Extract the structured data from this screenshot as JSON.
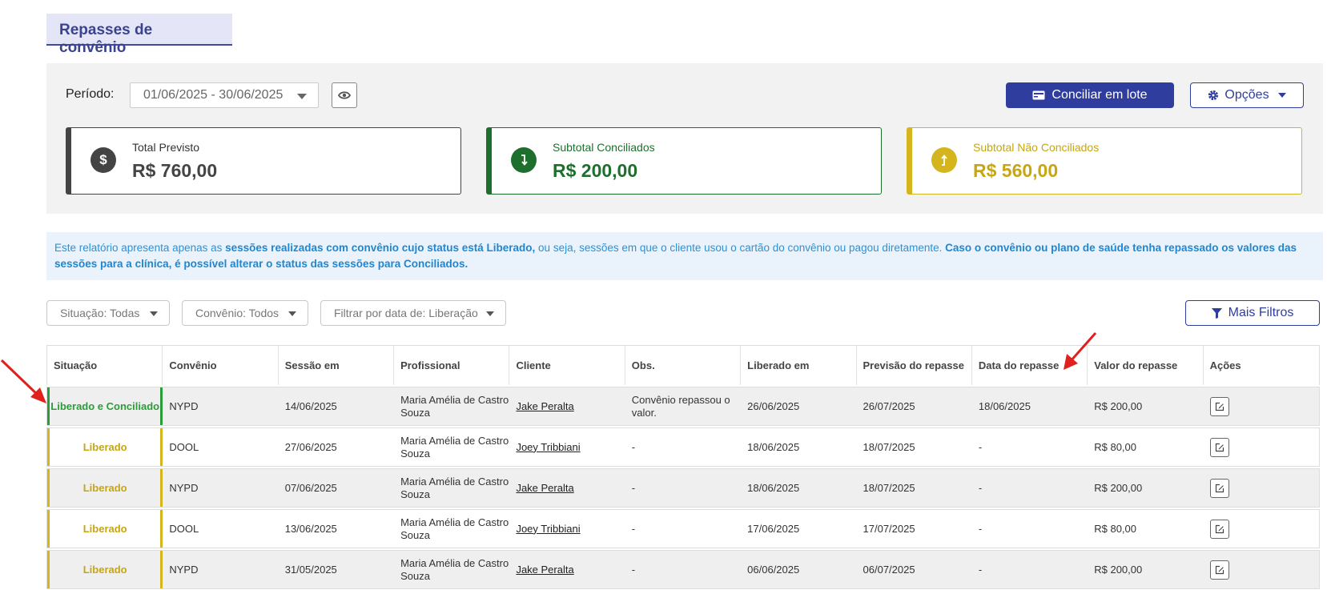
{
  "header": {
    "title": "Repasses de convênio"
  },
  "period": {
    "label": "Período:",
    "value": "01/06/2025 - 30/06/2025"
  },
  "toolbar": {
    "reconcile_batch_label": "Conciliar em lote",
    "options_label": "Opções"
  },
  "cards": {
    "total": {
      "label": "Total Previsto",
      "value": "R$ 760,00"
    },
    "conciliados": {
      "label": "Subtotal Conciliados",
      "value": "R$ 200,00"
    },
    "nao_conciliados": {
      "label": "Subtotal Não Conciliados",
      "value": "R$ 560,00"
    }
  },
  "info": {
    "p1": "Este relatório apresenta apenas as ",
    "b1": "sessões realizadas com convênio cujo status está Liberado,",
    "p2": " ou seja, sessões em que o cliente usou o cartão do convênio ou pagou diretamente. ",
    "b2": "Caso o convênio ou plano de saúde tenha repassado os valores das sessões para a clínica, é possível alterar o status das sessões para Conciliados."
  },
  "filters": {
    "situacao": "Situação: Todas",
    "convenio": "Convênio: Todos",
    "data": "Filtrar por data de: Liberação",
    "more_label": "Mais Filtros"
  },
  "table": {
    "columns": [
      "Situação",
      "Convênio",
      "Sessão em",
      "Profissional",
      "Cliente",
      "Obs.",
      "Liberado em",
      "Previsão do repasse",
      "Data do repasse",
      "Valor do repasse",
      "Ações"
    ],
    "rows": [
      {
        "status": "Liberado e Conciliado",
        "status_type": "conciliado",
        "convenio": "NYPD",
        "sessao": "14/06/2025",
        "profissional": "Maria Amélia de Castro Souza",
        "cliente": "Jake Peralta",
        "obs": "Convênio repassou o valor.",
        "liberado": "26/06/2025",
        "previsao": "26/07/2025",
        "data_repasse": "18/06/2025",
        "valor": "R$ 200,00"
      },
      {
        "status": "Liberado",
        "status_type": "liberado",
        "convenio": "DOOL",
        "sessao": "27/06/2025",
        "profissional": "Maria Amélia de Castro Souza",
        "cliente": "Joey Tribbiani",
        "obs": "-",
        "liberado": "18/06/2025",
        "previsao": "18/07/2025",
        "data_repasse": "-",
        "valor": "R$ 80,00"
      },
      {
        "status": "Liberado",
        "status_type": "liberado",
        "convenio": "NYPD",
        "sessao": "07/06/2025",
        "profissional": "Maria Amélia de Castro Souza",
        "cliente": "Jake Peralta",
        "obs": "-",
        "liberado": "18/06/2025",
        "previsao": "18/07/2025",
        "data_repasse": "-",
        "valor": "R$ 200,00"
      },
      {
        "status": "Liberado",
        "status_type": "liberado",
        "convenio": "DOOL",
        "sessao": "13/06/2025",
        "profissional": "Maria Amélia de Castro Souza",
        "cliente": "Joey Tribbiani",
        "obs": "-",
        "liberado": "17/06/2025",
        "previsao": "17/07/2025",
        "data_repasse": "-",
        "valor": "R$ 80,00"
      },
      {
        "status": "Liberado",
        "status_type": "liberado",
        "convenio": "NYPD",
        "sessao": "31/05/2025",
        "profissional": "Maria Amélia de Castro Souza",
        "cliente": "Jake Peralta",
        "obs": "-",
        "liberado": "06/06/2025",
        "previsao": "06/07/2025",
        "data_repasse": "-",
        "valor": "R$ 200,00"
      }
    ]
  },
  "icons": {
    "eye": "eye-icon",
    "card": "credit-card-icon",
    "gear": "gear-icon",
    "dollar": "dollar-icon",
    "arrow_down": "arrow-down-icon",
    "arrow_up": "arrow-up-icon",
    "filter": "filter-icon",
    "edit": "edit-icon"
  },
  "colors": {
    "primary": "#2f3e9e",
    "conciliado": "#2c9c3a",
    "liberado": "#d4b51e",
    "info": "#2b91d6",
    "annotation": "#e0201c"
  }
}
